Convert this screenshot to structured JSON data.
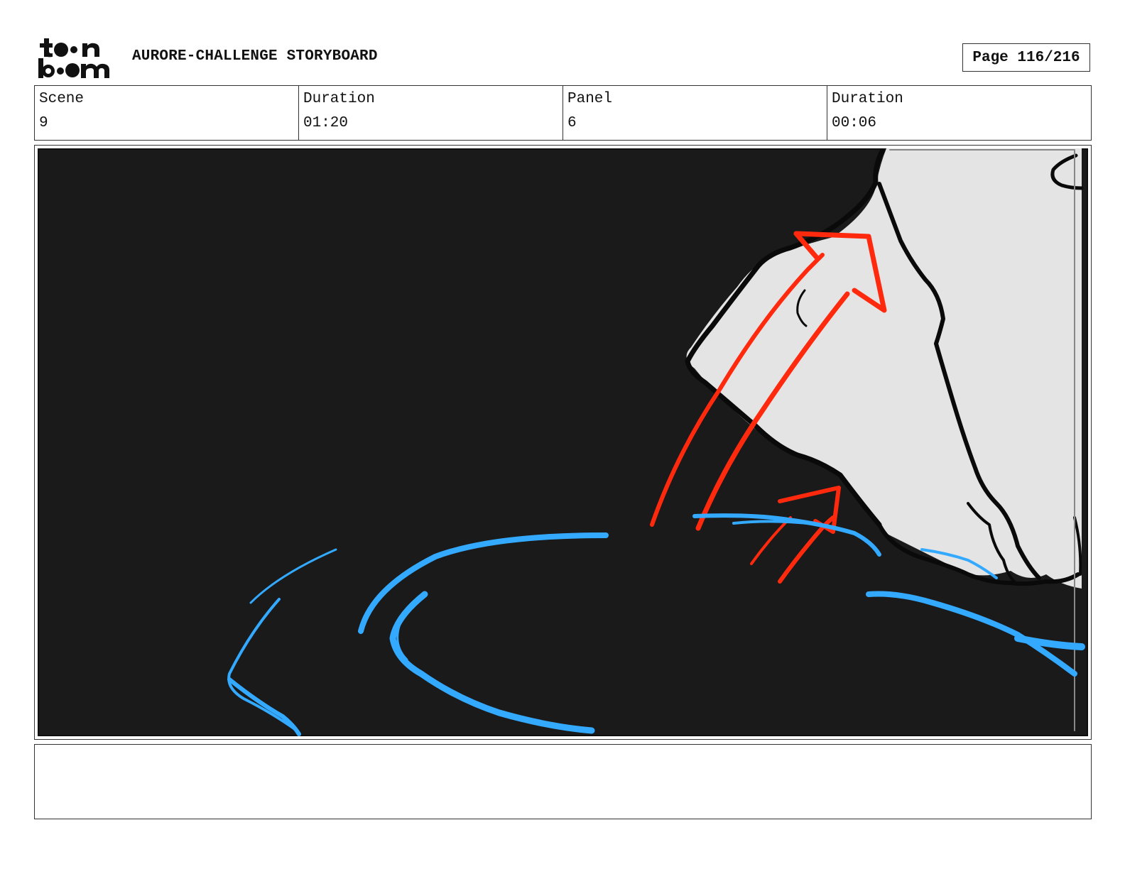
{
  "header": {
    "logo_label": "toon boom",
    "title": "AURORE-CHALLENGE STORYBOARD",
    "page_indicator": "Page 116/216"
  },
  "info": {
    "scene_label": "Scene",
    "scene_value": "9",
    "scene_duration_label": "Duration",
    "scene_duration_value": "01:20",
    "panel_label": "Panel",
    "panel_value": "6",
    "panel_duration_label": "Duration",
    "panel_duration_value": "00:06"
  },
  "panel": {
    "background_color": "#1a1a1a",
    "shape_fill_color": "#e4e4e4",
    "arrow_color": "#ff2a0e",
    "motion_line_color": "#33aaff"
  },
  "notes": {
    "text": ""
  }
}
